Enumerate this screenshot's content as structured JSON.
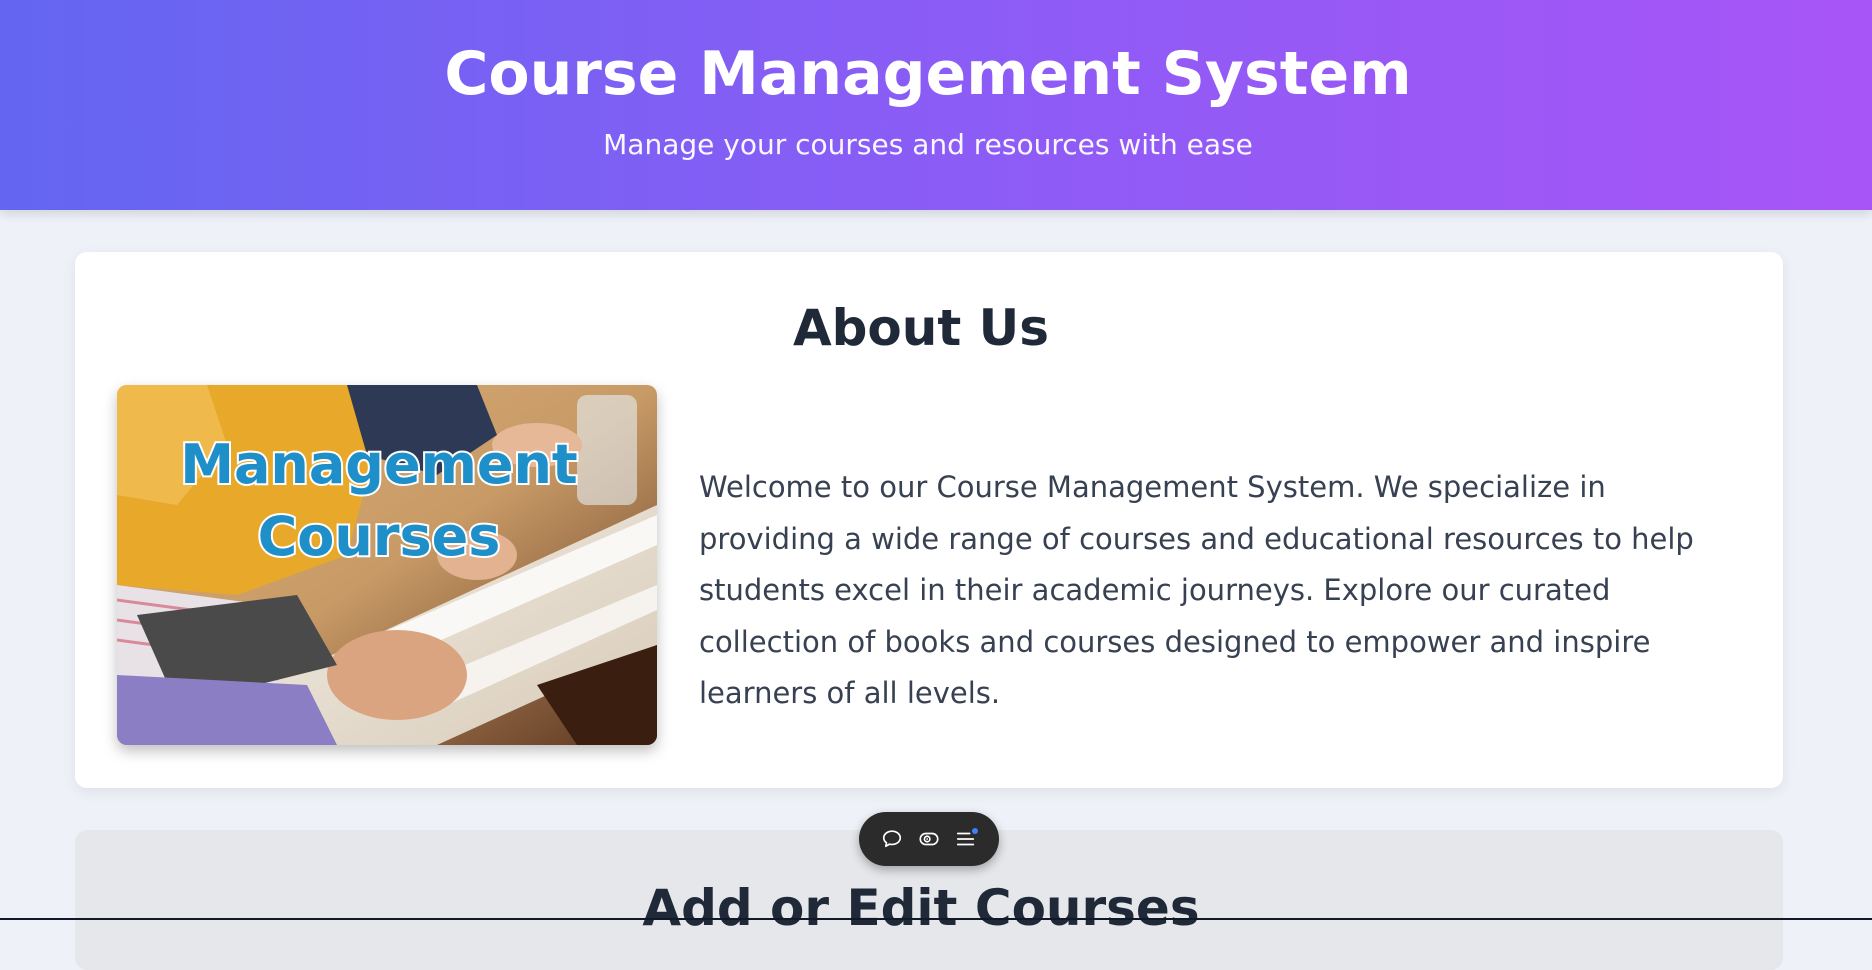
{
  "header": {
    "title": "Course Management System",
    "subtitle": "Manage your courses and resources with ease"
  },
  "about": {
    "title": "About Us",
    "image_text_line1": "Management",
    "image_text_line2": "Courses",
    "description": "Welcome to our Course Management System. We specialize in providing a wide range of courses and educational resources to help students excel in their academic journeys. Explore our curated collection of books and courses designed to empower and inspire learners of all levels."
  },
  "edit": {
    "title": "Add or Edit Courses"
  },
  "toolbar": {
    "items": [
      "chat-icon",
      "eye-icon",
      "menu-icon"
    ]
  },
  "colors": {
    "header_gradient_start": "#6366f1",
    "header_gradient_end": "#a855f7",
    "image_text": "#1e8fc8",
    "toolbar_bg": "#2b2b2b",
    "notify_dot": "#3b82f6"
  }
}
